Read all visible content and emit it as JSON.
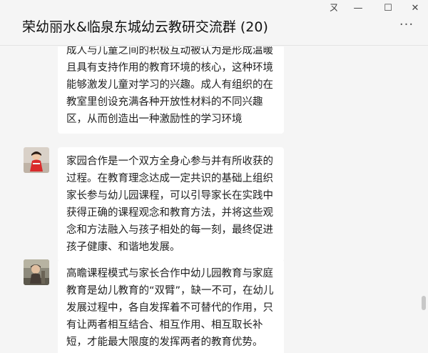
{
  "window": {
    "title": "荣幼丽水&临泉东城幼云教研交流群 (20)",
    "controls": {
      "pin": "ㄡ",
      "minimize": "—",
      "maximize": "☐",
      "close": "✕"
    },
    "more": "···"
  },
  "messages": [
    {
      "text": "成人与儿童之间的积极互动被认为是形成温暖且具有支持作用的教育环境的核心，这种环境能够激发儿童对学习的兴趣。成人有组织的在教室里创设充满各种开放性材料的不同兴趣区，从而创造出一种激励性的学习环境",
      "avatar": "none"
    },
    {
      "text": "家园合作是一个双方全身心参与并有所收获的过程。在教育理念达成一定共识的基础上组织家长参与幼儿园课程，可以引导家长在实践中获得正确的课程观念和教育方法，并将这些观念和方法融入与孩子相处的每一刻，最终促进孩子健康、和谐地发展。",
      "avatar": "child-in-red-avatar"
    },
    {
      "text": "高瞻课程模式与家长合作中幼儿园教育与家庭教育是幼儿教育的“双臂”，缺一不可，在幼儿发展过程中，各自发挥着不可替代的作用，只有让两者相互结合、相互作用、相互取长补短，才能最大限度的发挥两者的教育优势。",
      "avatar": "child-outdoor-avatar"
    }
  ],
  "colors": {
    "background": "#f5f5f5",
    "bubble": "#ffffff",
    "text": "#1f1f1f"
  }
}
